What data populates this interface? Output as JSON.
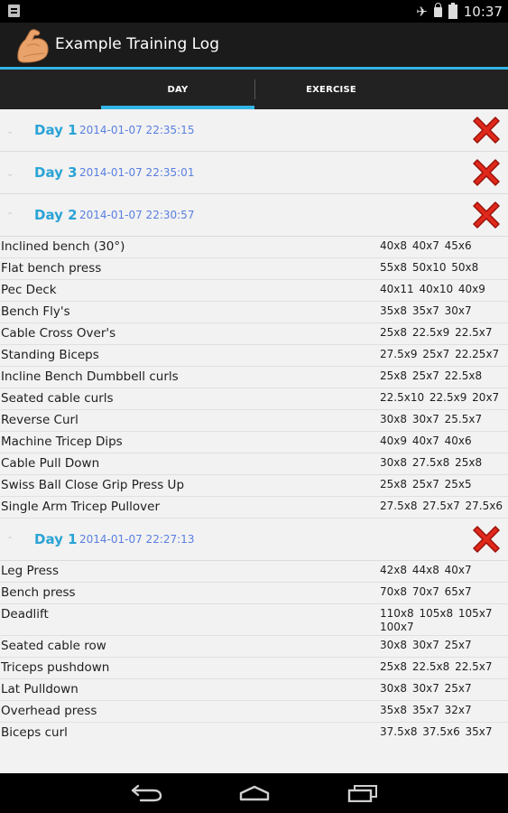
{
  "status": {
    "time": "10:37"
  },
  "app": {
    "title": "Example Training Log"
  },
  "tabs": [
    {
      "label": "DAY"
    },
    {
      "label": "EXERCISE"
    }
  ],
  "groups": [
    {
      "day": "Day 1",
      "timestamp": "2014-01-07 22:35:15",
      "expanded": false,
      "rows": []
    },
    {
      "day": "Day 3",
      "timestamp": "2014-01-07 22:35:01",
      "expanded": false,
      "rows": []
    },
    {
      "day": "Day 2",
      "timestamp": "2014-01-07 22:30:57",
      "expanded": true,
      "rows": [
        {
          "exercise": "Inclined bench (30°)",
          "sets": "40x8 40x7 45x6"
        },
        {
          "exercise": "Flat bench press",
          "sets": "55x8 50x10 50x8"
        },
        {
          "exercise": "Pec Deck",
          "sets": "40x11 40x10 40x9"
        },
        {
          "exercise": "Bench Fly's",
          "sets": "35x8 35x7 30x7"
        },
        {
          "exercise": "Cable Cross Over's",
          "sets": "25x8 22.5x9 22.5x7"
        },
        {
          "exercise": "Standing Biceps",
          "sets": "27.5x9 25x7 22.25x7"
        },
        {
          "exercise": "Incline Bench Dumbbell curls",
          "sets": "25x8 25x7 22.5x8"
        },
        {
          "exercise": "Seated cable curls",
          "sets": "22.5x10 22.5x9 20x7"
        },
        {
          "exercise": "Reverse Curl",
          "sets": "30x8 30x7 25.5x7"
        },
        {
          "exercise": "Machine Tricep Dips",
          "sets": "40x9 40x7 40x6"
        },
        {
          "exercise": "Cable Pull Down",
          "sets": "30x8 27.5x8 25x8"
        },
        {
          "exercise": "Swiss Ball Close Grip Press Up",
          "sets": "25x8 25x7 25x5"
        },
        {
          "exercise": "Single Arm Tricep Pullover",
          "sets": "27.5x8 27.5x7 27.5x6"
        }
      ]
    },
    {
      "day": "Day 1",
      "timestamp": "2014-01-07 22:27:13",
      "expanded": true,
      "rows": [
        {
          "exercise": "Leg Press",
          "sets": "42x8 44x8 40x7"
        },
        {
          "exercise": "Bench press",
          "sets": "70x8 70x7 65x7"
        },
        {
          "exercise": "Deadlift",
          "sets": "110x8 105x8 105x7 100x7",
          "tall": true
        },
        {
          "exercise": "Seated cable row",
          "sets": "30x8 30x7 25x7"
        },
        {
          "exercise": "Triceps pushdown",
          "sets": "25x8 22.5x8 22.5x7"
        },
        {
          "exercise": "Lat Pulldown",
          "sets": "30x8 30x7 25x7"
        },
        {
          "exercise": "Overhead press",
          "sets": "35x8 35x7 32x7"
        },
        {
          "exercise": "Biceps curl",
          "sets": "37.5x8 37.5x6 35x7"
        }
      ]
    }
  ],
  "colors": {
    "accent": "#33b5e5",
    "day_name": "#2aa3d6",
    "timestamp": "#5a7fe0",
    "delete": "#e0281c"
  },
  "icons": {
    "status_notification": "notification-icon",
    "airplane": "airplane-icon",
    "lock": "lock-icon",
    "battery": "battery-icon",
    "app_logo": "bicep-icon",
    "delete": "delete-x-icon",
    "back": "back-icon",
    "home": "home-icon",
    "recents": "recents-icon"
  }
}
